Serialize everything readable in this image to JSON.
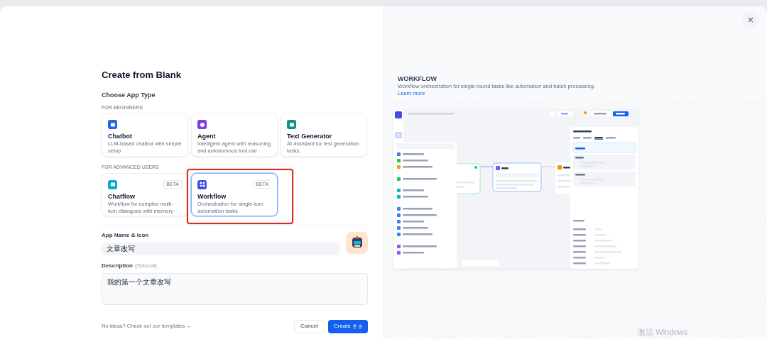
{
  "title": "Create from Blank",
  "app_type": {
    "heading": "Choose App Type",
    "groups": [
      {
        "label": "FOR BEGINNERS",
        "cards": [
          {
            "kind": "chatbot",
            "title": "Chatbot",
            "description": "LLM-based chatbot with simple setup",
            "selected": false
          },
          {
            "kind": "agent",
            "title": "Agent",
            "description": "Intelligent agent with reasoning and autonomous tool use",
            "selected": false
          },
          {
            "kind": "generator",
            "title": "Text Generator",
            "description": "AI assistant for test generation tasks",
            "selected": false
          }
        ]
      },
      {
        "label": "FOR ADVANCED USERS",
        "cards": [
          {
            "kind": "chatflow",
            "title": "Chatflow",
            "badge": "BETA",
            "description": "Workflow for complex multi-turn dialogues with memory",
            "selected": false
          },
          {
            "kind": "workflow",
            "title": "Workflow",
            "badge": "BETA",
            "description": "Orchestration for single-turn automation tasks",
            "selected": true
          }
        ]
      }
    ]
  },
  "name_field": {
    "label": "App Name & Icon",
    "value": "文章改写"
  },
  "description_field": {
    "label": "Description",
    "hint": "(Optional)",
    "value": "我的第一个文章改写"
  },
  "footer": {
    "link": "No ideas? Check out our templates →",
    "cancel": "Cancel",
    "create": "Create",
    "keys": [
      "⌘",
      "↵"
    ]
  },
  "preview": {
    "title": "WORKFLOW",
    "description": "Workflow orchestration for single-round tasks like automation and batch processing.",
    "link": "Learn more"
  },
  "os_notice": "激活 Windows"
}
